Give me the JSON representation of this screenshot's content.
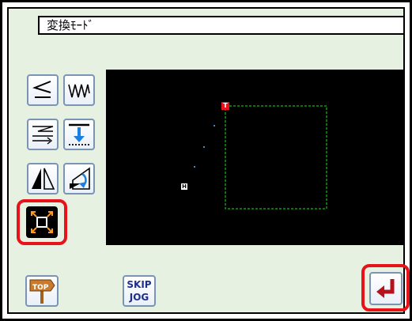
{
  "header": {
    "mode_label": "変換ﾓｰﾄﾞ"
  },
  "tools": [
    {
      "name": "pitch-compress-icon",
      "selected": false
    },
    {
      "name": "zigzag-icon",
      "selected": false
    },
    {
      "name": "multi-offset-icon",
      "selected": false
    },
    {
      "name": "move-down-icon",
      "selected": false
    },
    {
      "name": "mirror-icon",
      "selected": false
    },
    {
      "name": "rotate-icon",
      "selected": false
    },
    {
      "name": "scale-icon",
      "selected": true
    }
  ],
  "canvas": {
    "start_marker": "T",
    "home_marker": "H"
  },
  "footer": {
    "top_label": "TOP",
    "skip_line1": "SKIP",
    "skip_line2": "JOG"
  },
  "colors": {
    "panel_bg": "#e6f1e2",
    "canvas_bg": "#000000",
    "path": "#19e619",
    "highlight": "#e8121a"
  }
}
